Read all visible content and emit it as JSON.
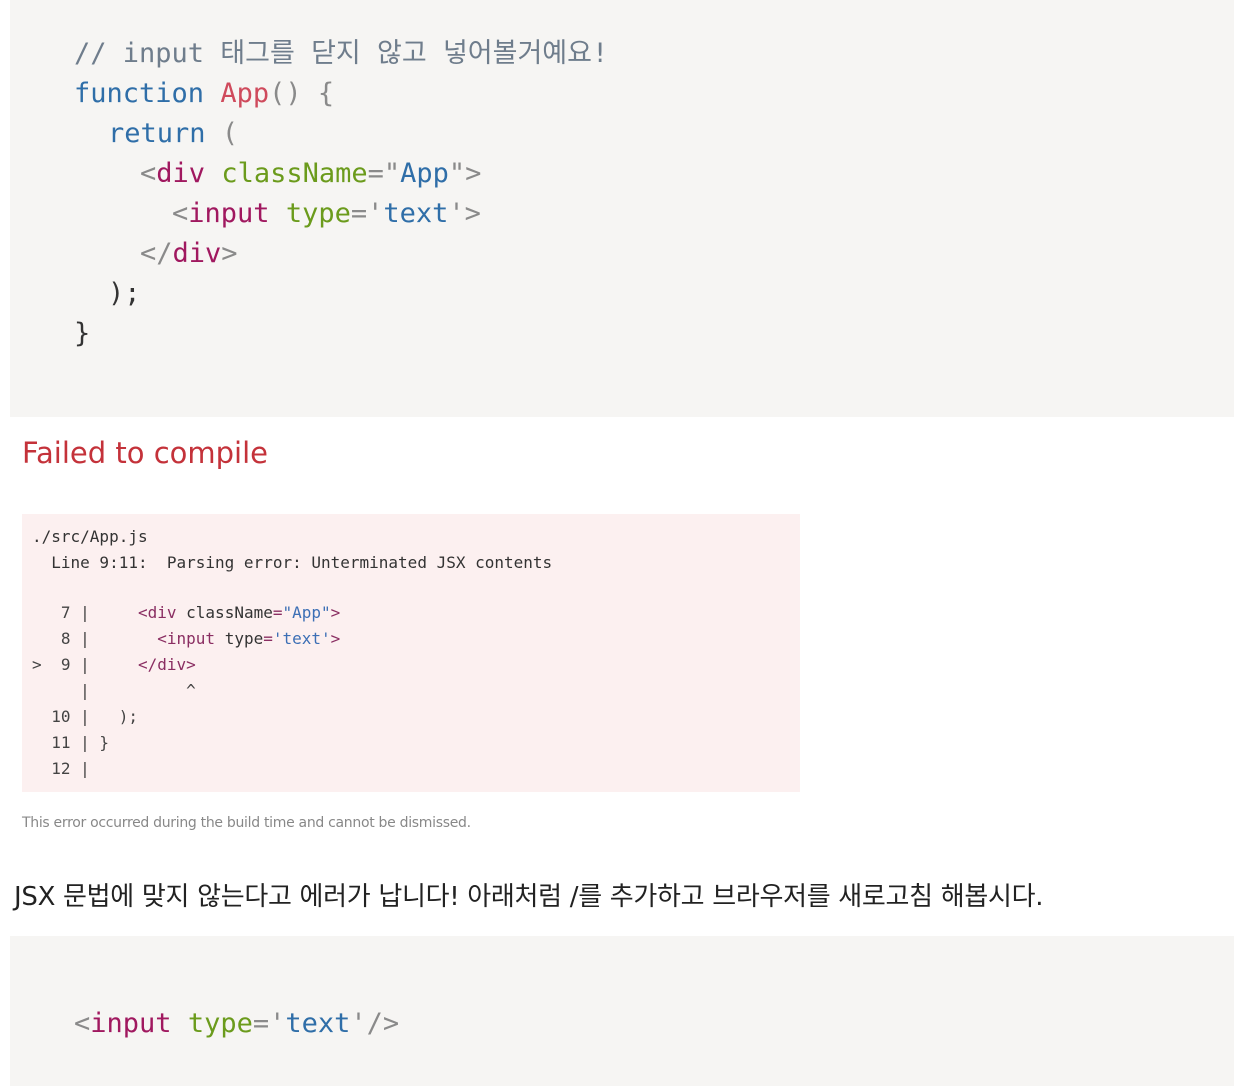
{
  "code_block_1": {
    "line1": "// input 태그를 닫지 않고 넣어볼거예요!",
    "line2": {
      "kw": "function",
      "name": "App",
      "rest": "() {"
    },
    "line3": {
      "kw": "return",
      "rest": "("
    },
    "line4": {
      "open": "<",
      "tag": "div",
      "attr": "className",
      "eq": "=\"",
      "value": "App",
      "close": "\">"
    },
    "line5": {
      "open": "<",
      "tag": "input",
      "attr": "type",
      "eq": "='",
      "value": "text",
      "close": "'>"
    },
    "line6": {
      "open": "</",
      "tag": "div",
      "close": ">"
    },
    "line7": ");",
    "line8": "}"
  },
  "error": {
    "title": "Failed to compile",
    "file": "./src/App.js",
    "message": "  Line 9:11:  Parsing error: Unterminated JSX contents",
    "lines": [
      {
        "prefix": "   7 |     ",
        "open": "<",
        "tag": "div",
        "sp": " ",
        "attr": "className",
        "eq": "=",
        "str": "\"App\"",
        "close": ">"
      },
      {
        "prefix": "   8 |       ",
        "open": "<",
        "tag": "input",
        "sp": " ",
        "attr": "type",
        "eq": "=",
        "str": "'text'",
        "close": ">"
      },
      {
        "prefix": ">  9 |     ",
        "open": "</",
        "tag": "div",
        "close": ">"
      },
      {
        "prefix": "     |          ^"
      },
      {
        "prefix": "  10 |   );"
      },
      {
        "prefix": "  11 | }"
      },
      {
        "prefix": "  12 |"
      }
    ],
    "note": "This error occurred during the build time and cannot be dismissed."
  },
  "paragraph": "JSX 문법에 맞지 않는다고 에러가 납니다! 아래처럼 /를 추가하고 브라우저를 새로고침 해봅시다.",
  "code_block_2": {
    "line1": {
      "open": "<",
      "tag": "input",
      "attr": "type",
      "eq": "='",
      "value": "text",
      "close": "'/>"
    }
  },
  "colors": {
    "code_bg": "#f6f5f3",
    "error_title": "#c4323a",
    "error_panel_bg": "#fcf0f0"
  }
}
